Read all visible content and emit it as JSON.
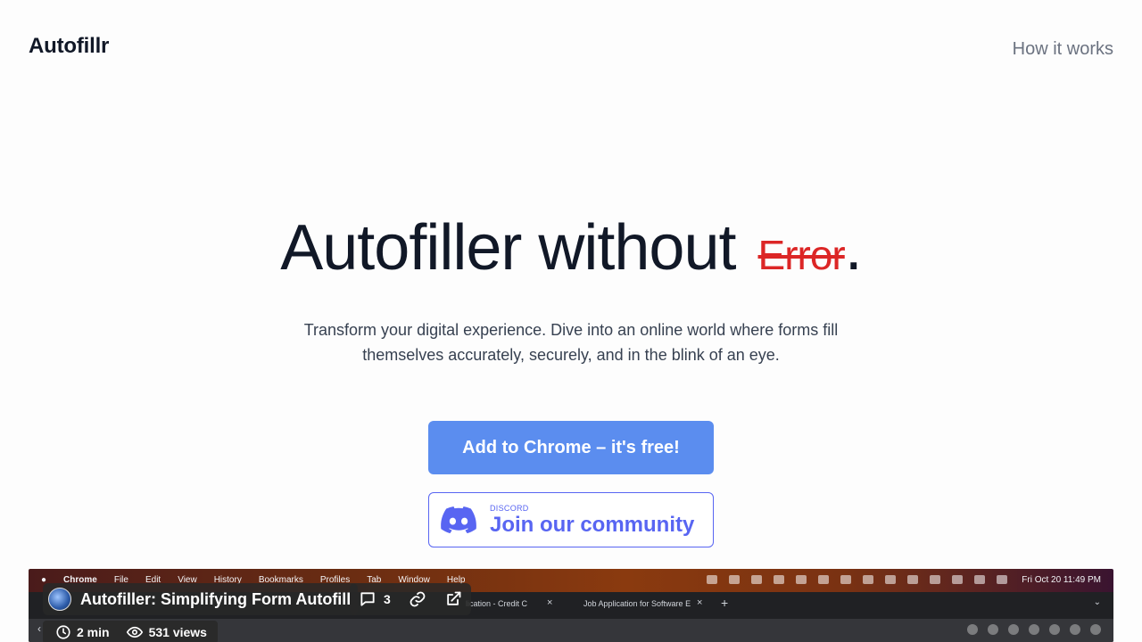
{
  "header": {
    "brand": "Autofillr",
    "nav_link": "How it works"
  },
  "hero": {
    "title_main": "Autofiller without",
    "title_struck": "Error",
    "title_period": ".",
    "subtitle": "Transform your digital experience. Dive into an online world where forms fill themselves accurately, securely, and in the blink of an eye."
  },
  "cta": {
    "label": "Add to Chrome – it's free!"
  },
  "discord": {
    "small_label": "DISCORD",
    "label": "Join our community"
  },
  "video": {
    "title": "Autofiller: Simplifying Form Autofill",
    "comments_count": "3",
    "duration": "2 min",
    "views": "531 views",
    "menubar": {
      "app": "Chrome",
      "items": [
        "File",
        "Edit",
        "View",
        "History",
        "Bookmarks",
        "Profiles",
        "Tab",
        "Window",
        "Help"
      ],
      "clock": "Fri Oct 20  11:49 PM"
    },
    "tabs": {
      "tab1": "lication - Credit C",
      "tab2": "Job Application for Software E"
    }
  },
  "colors": {
    "accent": "#5b8def",
    "discord": "#5865f2",
    "error": "#dc2626"
  }
}
